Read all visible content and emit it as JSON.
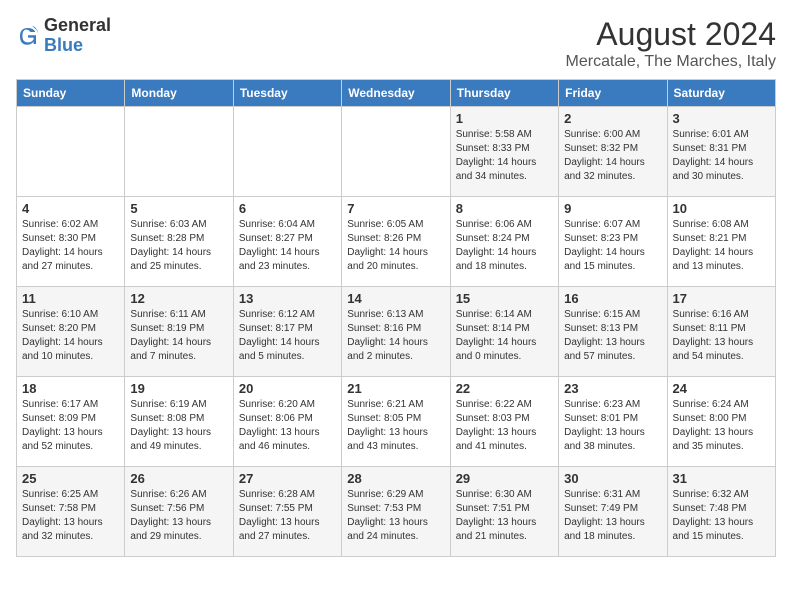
{
  "logo": {
    "line1": "General",
    "line2": "Blue"
  },
  "title": "August 2024",
  "subtitle": "Mercatale, The Marches, Italy",
  "days_of_week": [
    "Sunday",
    "Monday",
    "Tuesday",
    "Wednesday",
    "Thursday",
    "Friday",
    "Saturday"
  ],
  "weeks": [
    [
      {
        "day": "",
        "info": ""
      },
      {
        "day": "",
        "info": ""
      },
      {
        "day": "",
        "info": ""
      },
      {
        "day": "",
        "info": ""
      },
      {
        "day": "1",
        "info": "Sunrise: 5:58 AM\nSunset: 8:33 PM\nDaylight: 14 hours\nand 34 minutes."
      },
      {
        "day": "2",
        "info": "Sunrise: 6:00 AM\nSunset: 8:32 PM\nDaylight: 14 hours\nand 32 minutes."
      },
      {
        "day": "3",
        "info": "Sunrise: 6:01 AM\nSunset: 8:31 PM\nDaylight: 14 hours\nand 30 minutes."
      }
    ],
    [
      {
        "day": "4",
        "info": "Sunrise: 6:02 AM\nSunset: 8:30 PM\nDaylight: 14 hours\nand 27 minutes."
      },
      {
        "day": "5",
        "info": "Sunrise: 6:03 AM\nSunset: 8:28 PM\nDaylight: 14 hours\nand 25 minutes."
      },
      {
        "day": "6",
        "info": "Sunrise: 6:04 AM\nSunset: 8:27 PM\nDaylight: 14 hours\nand 23 minutes."
      },
      {
        "day": "7",
        "info": "Sunrise: 6:05 AM\nSunset: 8:26 PM\nDaylight: 14 hours\nand 20 minutes."
      },
      {
        "day": "8",
        "info": "Sunrise: 6:06 AM\nSunset: 8:24 PM\nDaylight: 14 hours\nand 18 minutes."
      },
      {
        "day": "9",
        "info": "Sunrise: 6:07 AM\nSunset: 8:23 PM\nDaylight: 14 hours\nand 15 minutes."
      },
      {
        "day": "10",
        "info": "Sunrise: 6:08 AM\nSunset: 8:21 PM\nDaylight: 14 hours\nand 13 minutes."
      }
    ],
    [
      {
        "day": "11",
        "info": "Sunrise: 6:10 AM\nSunset: 8:20 PM\nDaylight: 14 hours\nand 10 minutes."
      },
      {
        "day": "12",
        "info": "Sunrise: 6:11 AM\nSunset: 8:19 PM\nDaylight: 14 hours\nand 7 minutes."
      },
      {
        "day": "13",
        "info": "Sunrise: 6:12 AM\nSunset: 8:17 PM\nDaylight: 14 hours\nand 5 minutes."
      },
      {
        "day": "14",
        "info": "Sunrise: 6:13 AM\nSunset: 8:16 PM\nDaylight: 14 hours\nand 2 minutes."
      },
      {
        "day": "15",
        "info": "Sunrise: 6:14 AM\nSunset: 8:14 PM\nDaylight: 14 hours\nand 0 minutes."
      },
      {
        "day": "16",
        "info": "Sunrise: 6:15 AM\nSunset: 8:13 PM\nDaylight: 13 hours\nand 57 minutes."
      },
      {
        "day": "17",
        "info": "Sunrise: 6:16 AM\nSunset: 8:11 PM\nDaylight: 13 hours\nand 54 minutes."
      }
    ],
    [
      {
        "day": "18",
        "info": "Sunrise: 6:17 AM\nSunset: 8:09 PM\nDaylight: 13 hours\nand 52 minutes."
      },
      {
        "day": "19",
        "info": "Sunrise: 6:19 AM\nSunset: 8:08 PM\nDaylight: 13 hours\nand 49 minutes."
      },
      {
        "day": "20",
        "info": "Sunrise: 6:20 AM\nSunset: 8:06 PM\nDaylight: 13 hours\nand 46 minutes."
      },
      {
        "day": "21",
        "info": "Sunrise: 6:21 AM\nSunset: 8:05 PM\nDaylight: 13 hours\nand 43 minutes."
      },
      {
        "day": "22",
        "info": "Sunrise: 6:22 AM\nSunset: 8:03 PM\nDaylight: 13 hours\nand 41 minutes."
      },
      {
        "day": "23",
        "info": "Sunrise: 6:23 AM\nSunset: 8:01 PM\nDaylight: 13 hours\nand 38 minutes."
      },
      {
        "day": "24",
        "info": "Sunrise: 6:24 AM\nSunset: 8:00 PM\nDaylight: 13 hours\nand 35 minutes."
      }
    ],
    [
      {
        "day": "25",
        "info": "Sunrise: 6:25 AM\nSunset: 7:58 PM\nDaylight: 13 hours\nand 32 minutes."
      },
      {
        "day": "26",
        "info": "Sunrise: 6:26 AM\nSunset: 7:56 PM\nDaylight: 13 hours\nand 29 minutes."
      },
      {
        "day": "27",
        "info": "Sunrise: 6:28 AM\nSunset: 7:55 PM\nDaylight: 13 hours\nand 27 minutes."
      },
      {
        "day": "28",
        "info": "Sunrise: 6:29 AM\nSunset: 7:53 PM\nDaylight: 13 hours\nand 24 minutes."
      },
      {
        "day": "29",
        "info": "Sunrise: 6:30 AM\nSunset: 7:51 PM\nDaylight: 13 hours\nand 21 minutes."
      },
      {
        "day": "30",
        "info": "Sunrise: 6:31 AM\nSunset: 7:49 PM\nDaylight: 13 hours\nand 18 minutes."
      },
      {
        "day": "31",
        "info": "Sunrise: 6:32 AM\nSunset: 7:48 PM\nDaylight: 13 hours\nand 15 minutes."
      }
    ]
  ]
}
